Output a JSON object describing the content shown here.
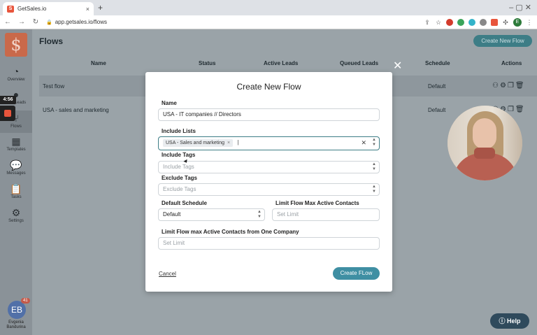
{
  "browser": {
    "tab_title": "GetSales.io",
    "tab_favicon": "S",
    "close_tab": "×",
    "new_tab": "+",
    "url": "app.getsales.io/flows",
    "window_controls": "–  ▢  ✕",
    "profile_initial": "E"
  },
  "sidebar": {
    "logo": "$",
    "items": [
      {
        "label": "Overview",
        "icon": "speedometer-icon"
      },
      {
        "label": "Leads",
        "icon": "person-icon"
      },
      {
        "label": "Flows",
        "icon": "flows-icon"
      },
      {
        "label": "Templates",
        "icon": "grid-icon"
      },
      {
        "label": "Messages",
        "icon": "chat-icon"
      },
      {
        "label": "Tasks",
        "icon": "clipboard-icon"
      },
      {
        "label": "Settings",
        "icon": "gear-icon"
      }
    ],
    "avatar_initials": "EB",
    "avatar_badge": "41",
    "user_first": "Evgenia",
    "user_last": "Bandurina"
  },
  "recording": {
    "time": "4:56"
  },
  "main": {
    "title": "Flows",
    "create_button": "Create New Flow",
    "columns": [
      "Name",
      "Status",
      "Active Leads",
      "Queued Leads",
      "Schedule",
      "Actions"
    ],
    "rows": [
      {
        "name": "Test flow",
        "schedule": "Default"
      },
      {
        "name": "USA - sales and marketing",
        "schedule": "Default"
      }
    ]
  },
  "modal": {
    "title": "Create New Flow",
    "name_label": "Name",
    "name_value": "USA - IT companies // Directors",
    "include_lists_label": "Include Lists",
    "include_lists_chip": "USA - Sales and marketing",
    "include_tags_label": "Include Tags",
    "include_tags_placeholder": "Include Tags",
    "exclude_tags_label": "Exclude Tags",
    "exclude_tags_placeholder": "Exclude Tags",
    "default_schedule_label": "Default Schedule",
    "default_schedule_value": "Default",
    "limit_flow_label": "Limit Flow Max Active Contacts",
    "limit_flow_placeholder": "Set Limit",
    "limit_company_label": "Limit Flow max Active Contacts from One Company",
    "limit_company_placeholder": "Set Limit",
    "cancel_label": "Cancel",
    "create_label": "Create FLow"
  },
  "help_label": "Help"
}
